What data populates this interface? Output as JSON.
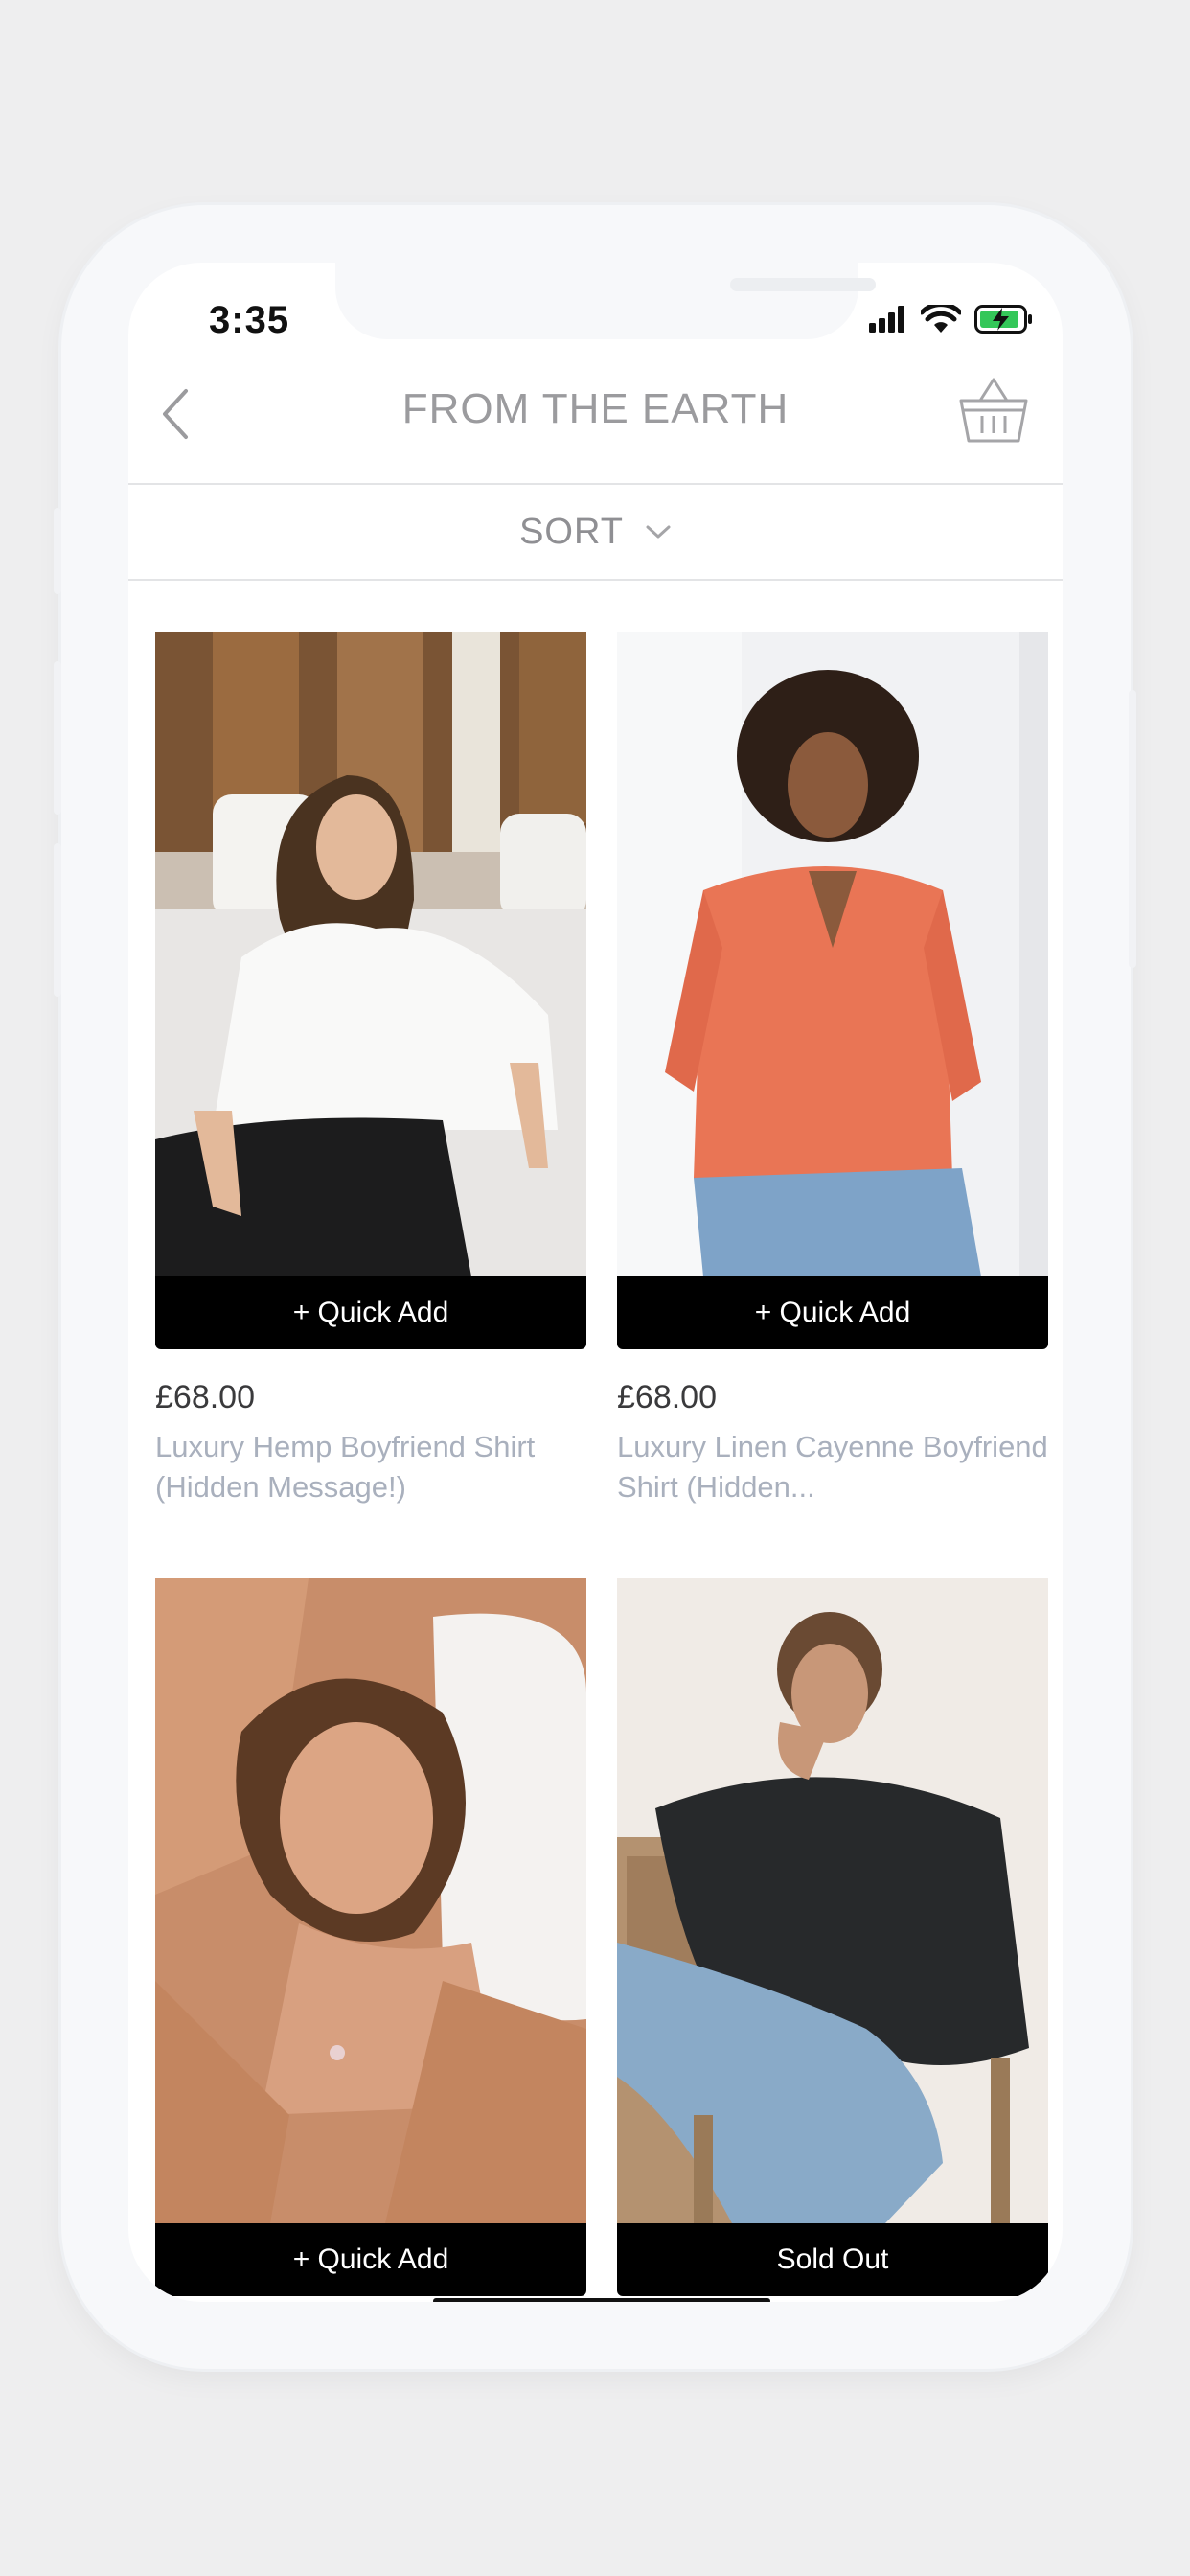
{
  "status_bar": {
    "time": "3:35"
  },
  "header": {
    "title": "FROM THE EARTH"
  },
  "sort": {
    "label": "SORT"
  },
  "products": [
    {
      "price": "£68.00",
      "name": "Luxury Hemp Boyfriend Shirt (Hidden Message!)",
      "action": "+ Quick Add"
    },
    {
      "price": "£68.00",
      "name": "Luxury Linen Cayenne Boyfriend Shirt (Hidden...",
      "action": "+ Quick Add"
    },
    {
      "price": "",
      "name": "",
      "action": "+ Quick Add"
    },
    {
      "price": "",
      "name": "",
      "action": "Sold Out"
    }
  ],
  "colors": {
    "accent": "#000000",
    "title": "#9b9b9e",
    "product_name": "#a9b0bd",
    "battery": "#34c759"
  },
  "icons": [
    "back-chevron-icon",
    "basket-icon",
    "chevron-down-icon",
    "signal-icon",
    "wifi-icon",
    "battery-charging-icon"
  ]
}
